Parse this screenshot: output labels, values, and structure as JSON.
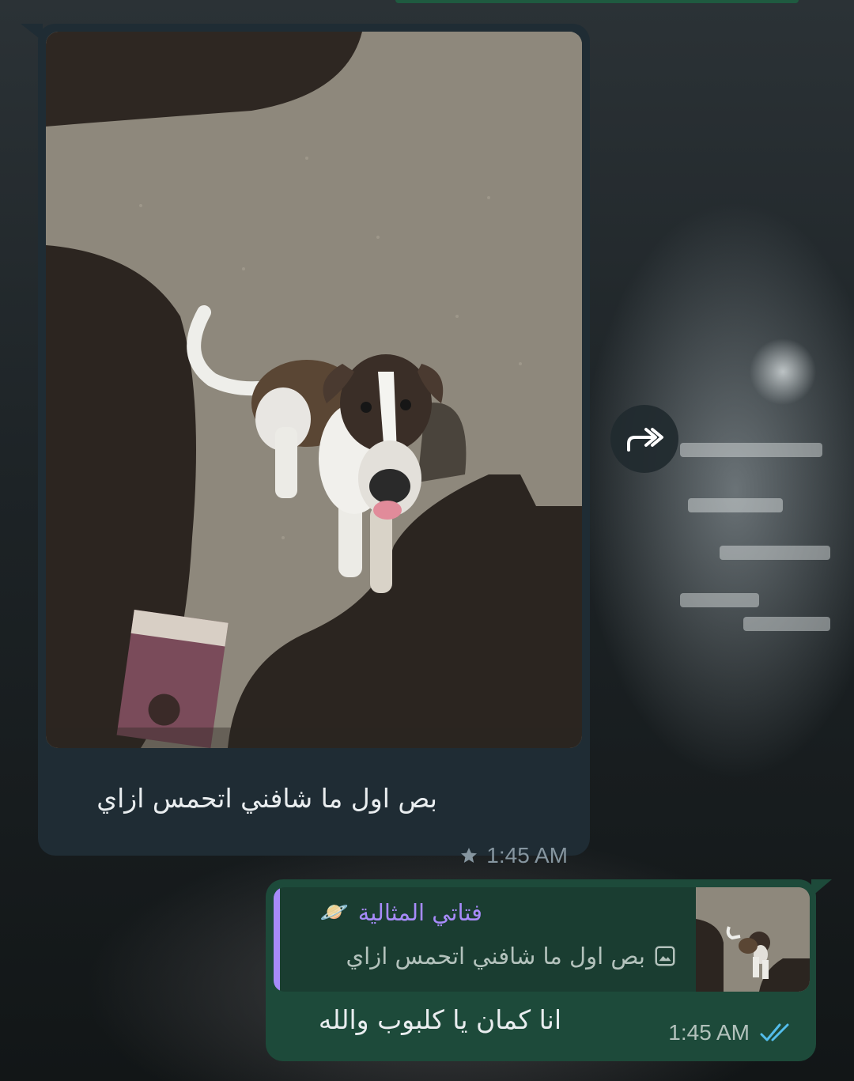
{
  "incoming_message": {
    "caption": "بص اول ما شافني اتحمس ازاي",
    "time": "1:45 AM",
    "starred": true,
    "star_icon": "star-icon"
  },
  "forward": {
    "icon": "forward-icon"
  },
  "outgoing_message": {
    "reply": {
      "sender_name": "فتاتي المثالية",
      "sender_emoji": "🪐",
      "quoted_text": "بص اول ما شافني اتحمس ازاي",
      "quoted_type_icon": "image-icon"
    },
    "text": "انا كمان يا كلبوب والله",
    "time": "1:45 AM",
    "status_icon": "double-check-icon"
  },
  "colors": {
    "incoming_bubble": "#1f2c34",
    "outgoing_bubble": "#1d4a3a",
    "reply_accent": "#a78bfa",
    "read_ticks": "#53bdeb"
  }
}
